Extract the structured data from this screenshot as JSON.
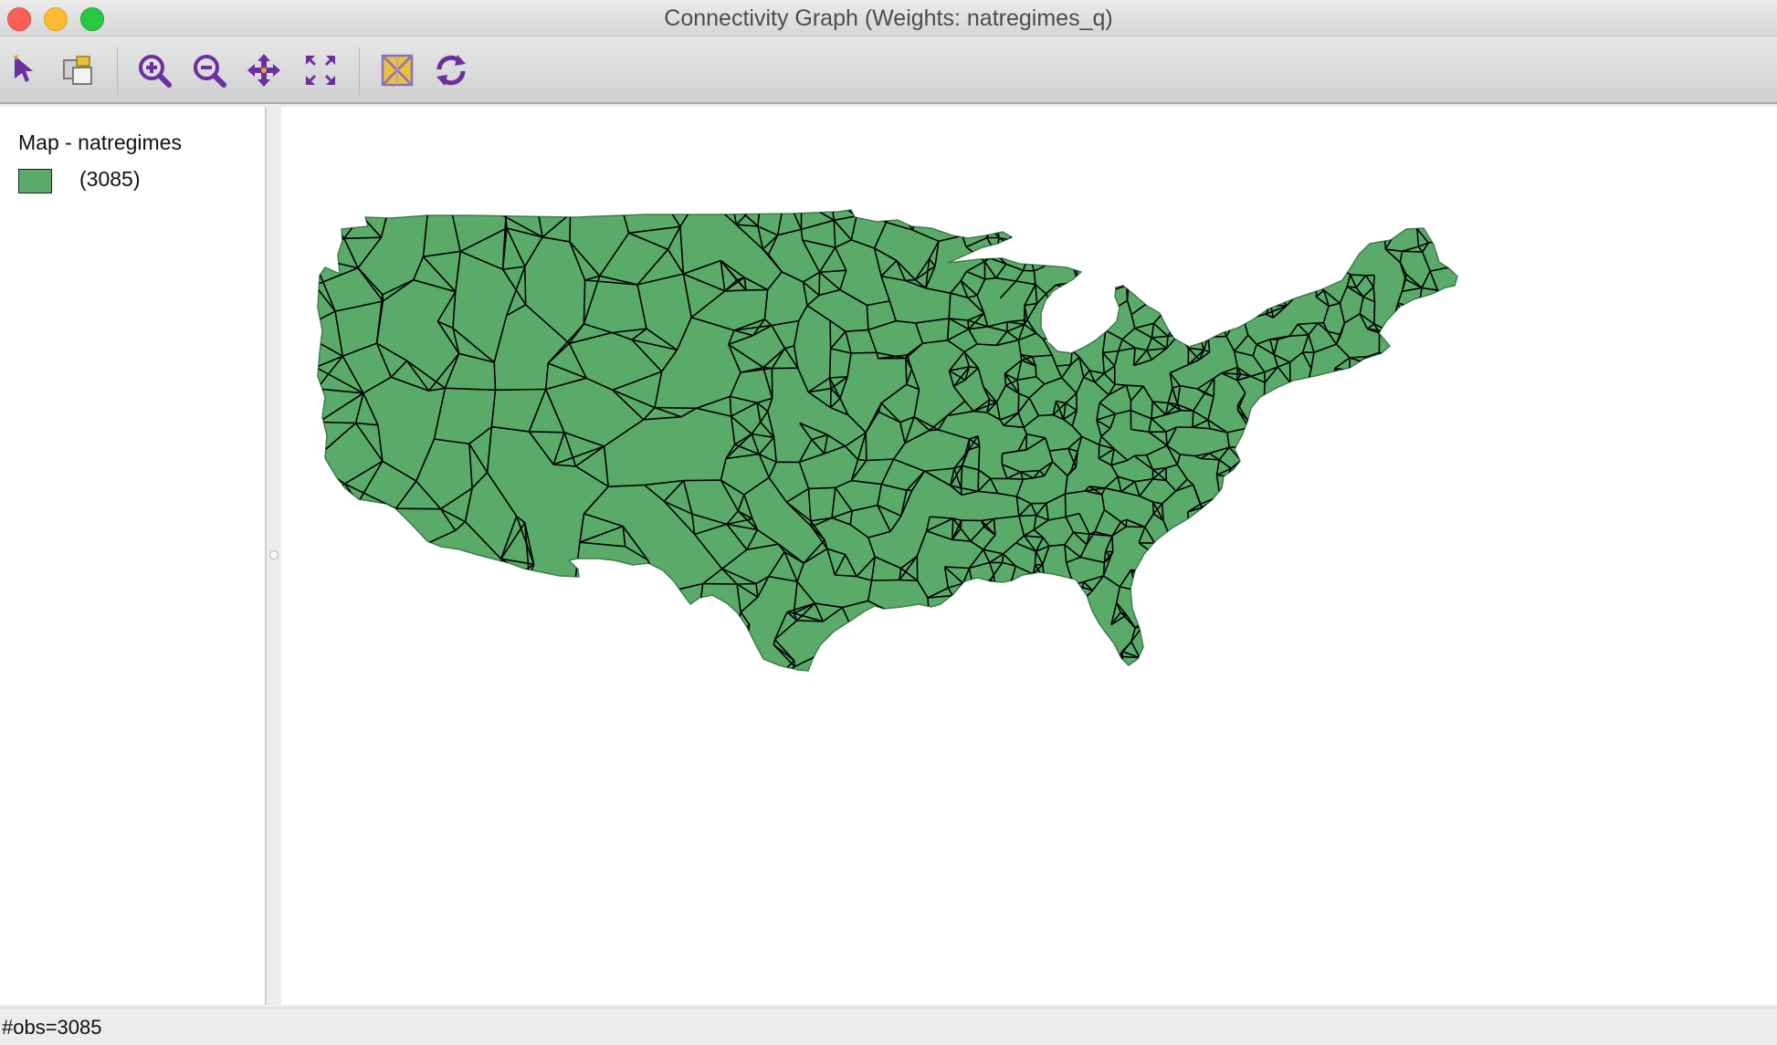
{
  "window": {
    "title": "Connectivity Graph (Weights: natregimes_q)"
  },
  "toolbar": {
    "tools": [
      {
        "name": "select-pointer-icon"
      },
      {
        "name": "selection-tool-icon"
      },
      {
        "name": "zoom-in-icon"
      },
      {
        "name": "zoom-out-icon"
      },
      {
        "name": "pan-icon"
      },
      {
        "name": "fit-extent-icon"
      },
      {
        "name": "toggle-map-icon"
      },
      {
        "name": "refresh-icon"
      }
    ]
  },
  "legend": {
    "title": "Map - natregimes",
    "items": [
      {
        "label": "(3085)",
        "color": "#5aab6a"
      }
    ]
  },
  "map": {
    "fill_color": "#5aab6a",
    "edge_color": "#000000"
  },
  "status": {
    "text": "#obs=3085"
  }
}
